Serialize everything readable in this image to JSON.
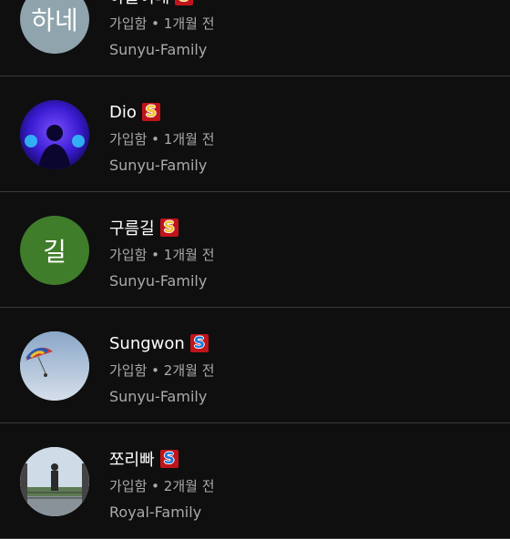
{
  "members": [
    {
      "name": "하늘이네",
      "avatar_text": "하네",
      "avatar_color": "#8fa4ad",
      "badge_letter": "S",
      "badge_bg": "#c0141b",
      "badge_fg": "#f2c230",
      "joined": "가입함 • 1개월 전",
      "group": "Sunyu-Family"
    },
    {
      "name": "Dio",
      "avatar_text": "",
      "avatar_color": "#2a1a9c",
      "badge_letter": "S",
      "badge_bg": "#c0141b",
      "badge_fg": "#f2c230",
      "joined": "가입함 • 1개월 전",
      "group": "Sunyu-Family"
    },
    {
      "name": "구름길",
      "avatar_text": "길",
      "avatar_color": "#3f7d2a",
      "badge_letter": "S",
      "badge_bg": "#c0141b",
      "badge_fg": "#f2c230",
      "joined": "가입함 • 1개월 전",
      "group": "Sunyu-Family"
    },
    {
      "name": "Sungwon",
      "avatar_text": "",
      "avatar_color": "#9fb7d6",
      "badge_letter": "S",
      "badge_bg": "#c0141b",
      "badge_fg": "#1e78d8",
      "joined": "가입함 • 2개월 전",
      "group": "Sunyu-Family"
    },
    {
      "name": "쪼리빠",
      "avatar_text": "",
      "avatar_color": "#b9cde0",
      "badge_letter": "S",
      "badge_bg": "#c0141b",
      "badge_fg": "#1e78d8",
      "joined": "가입함 • 2개월 전",
      "group": "Royal-Family"
    }
  ]
}
